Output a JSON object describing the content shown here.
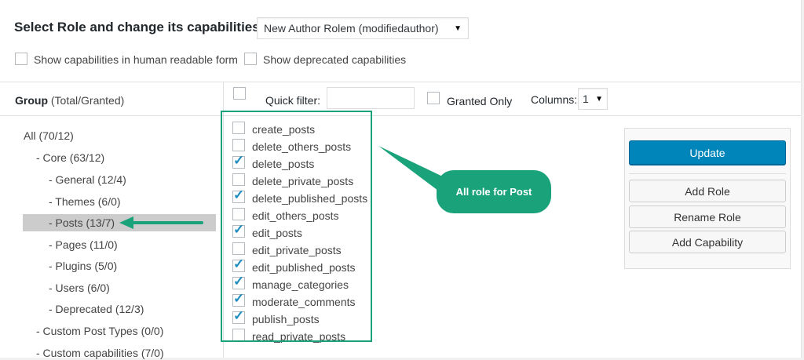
{
  "header": {
    "title": "Select Role and change its capabilities:",
    "role_select_value": "New Author Rolem (modifiedauthor)"
  },
  "options": {
    "human_readable_label": "Show capabilities in human readable form",
    "deprecated_label": "Show deprecated capabilities"
  },
  "groups": {
    "heading_bold": "Group",
    "heading_rest": "(Total/Granted)",
    "items": [
      {
        "label": "All (70/12)",
        "selected": false
      },
      {
        "label": "- Core (63/12)",
        "selected": false
      },
      {
        "label": "- General (12/4)",
        "selected": false
      },
      {
        "label": "- Themes (6/0)",
        "selected": false
      },
      {
        "label": "- Posts (13/7)",
        "selected": true
      },
      {
        "label": "- Pages (11/0)",
        "selected": false
      },
      {
        "label": "- Plugins (5/0)",
        "selected": false
      },
      {
        "label": "- Users (6/0)",
        "selected": false
      },
      {
        "label": "- Deprecated (12/3)",
        "selected": false
      },
      {
        "label": "- Custom Post Types (0/0)",
        "selected": false
      },
      {
        "label": "- Custom capabilities (7/0)",
        "selected": false
      }
    ]
  },
  "toolbar": {
    "quick_filter_label": "Quick filter:",
    "quick_filter_value": "",
    "granted_only_label": "Granted Only",
    "columns_label": "Columns:",
    "columns_value": "1"
  },
  "capabilities": [
    {
      "name": "create_posts",
      "checked": false
    },
    {
      "name": "delete_others_posts",
      "checked": false
    },
    {
      "name": "delete_posts",
      "checked": true
    },
    {
      "name": "delete_private_posts",
      "checked": false
    },
    {
      "name": "delete_published_posts",
      "checked": true
    },
    {
      "name": "edit_others_posts",
      "checked": false
    },
    {
      "name": "edit_posts",
      "checked": true
    },
    {
      "name": "edit_private_posts",
      "checked": false
    },
    {
      "name": "edit_published_posts",
      "checked": true
    },
    {
      "name": "manage_categories",
      "checked": true
    },
    {
      "name": "moderate_comments",
      "checked": true
    },
    {
      "name": "publish_posts",
      "checked": true
    },
    {
      "name": "read_private_posts",
      "checked": false
    }
  ],
  "actions": {
    "update": "Update",
    "add_role": "Add Role",
    "rename_role": "Rename Role",
    "add_capability": "Add Capability"
  },
  "annotation": {
    "callout_text": "All role for Post",
    "accent_color": "#1aa37a",
    "highlight_box_color": "#1aa37a"
  }
}
